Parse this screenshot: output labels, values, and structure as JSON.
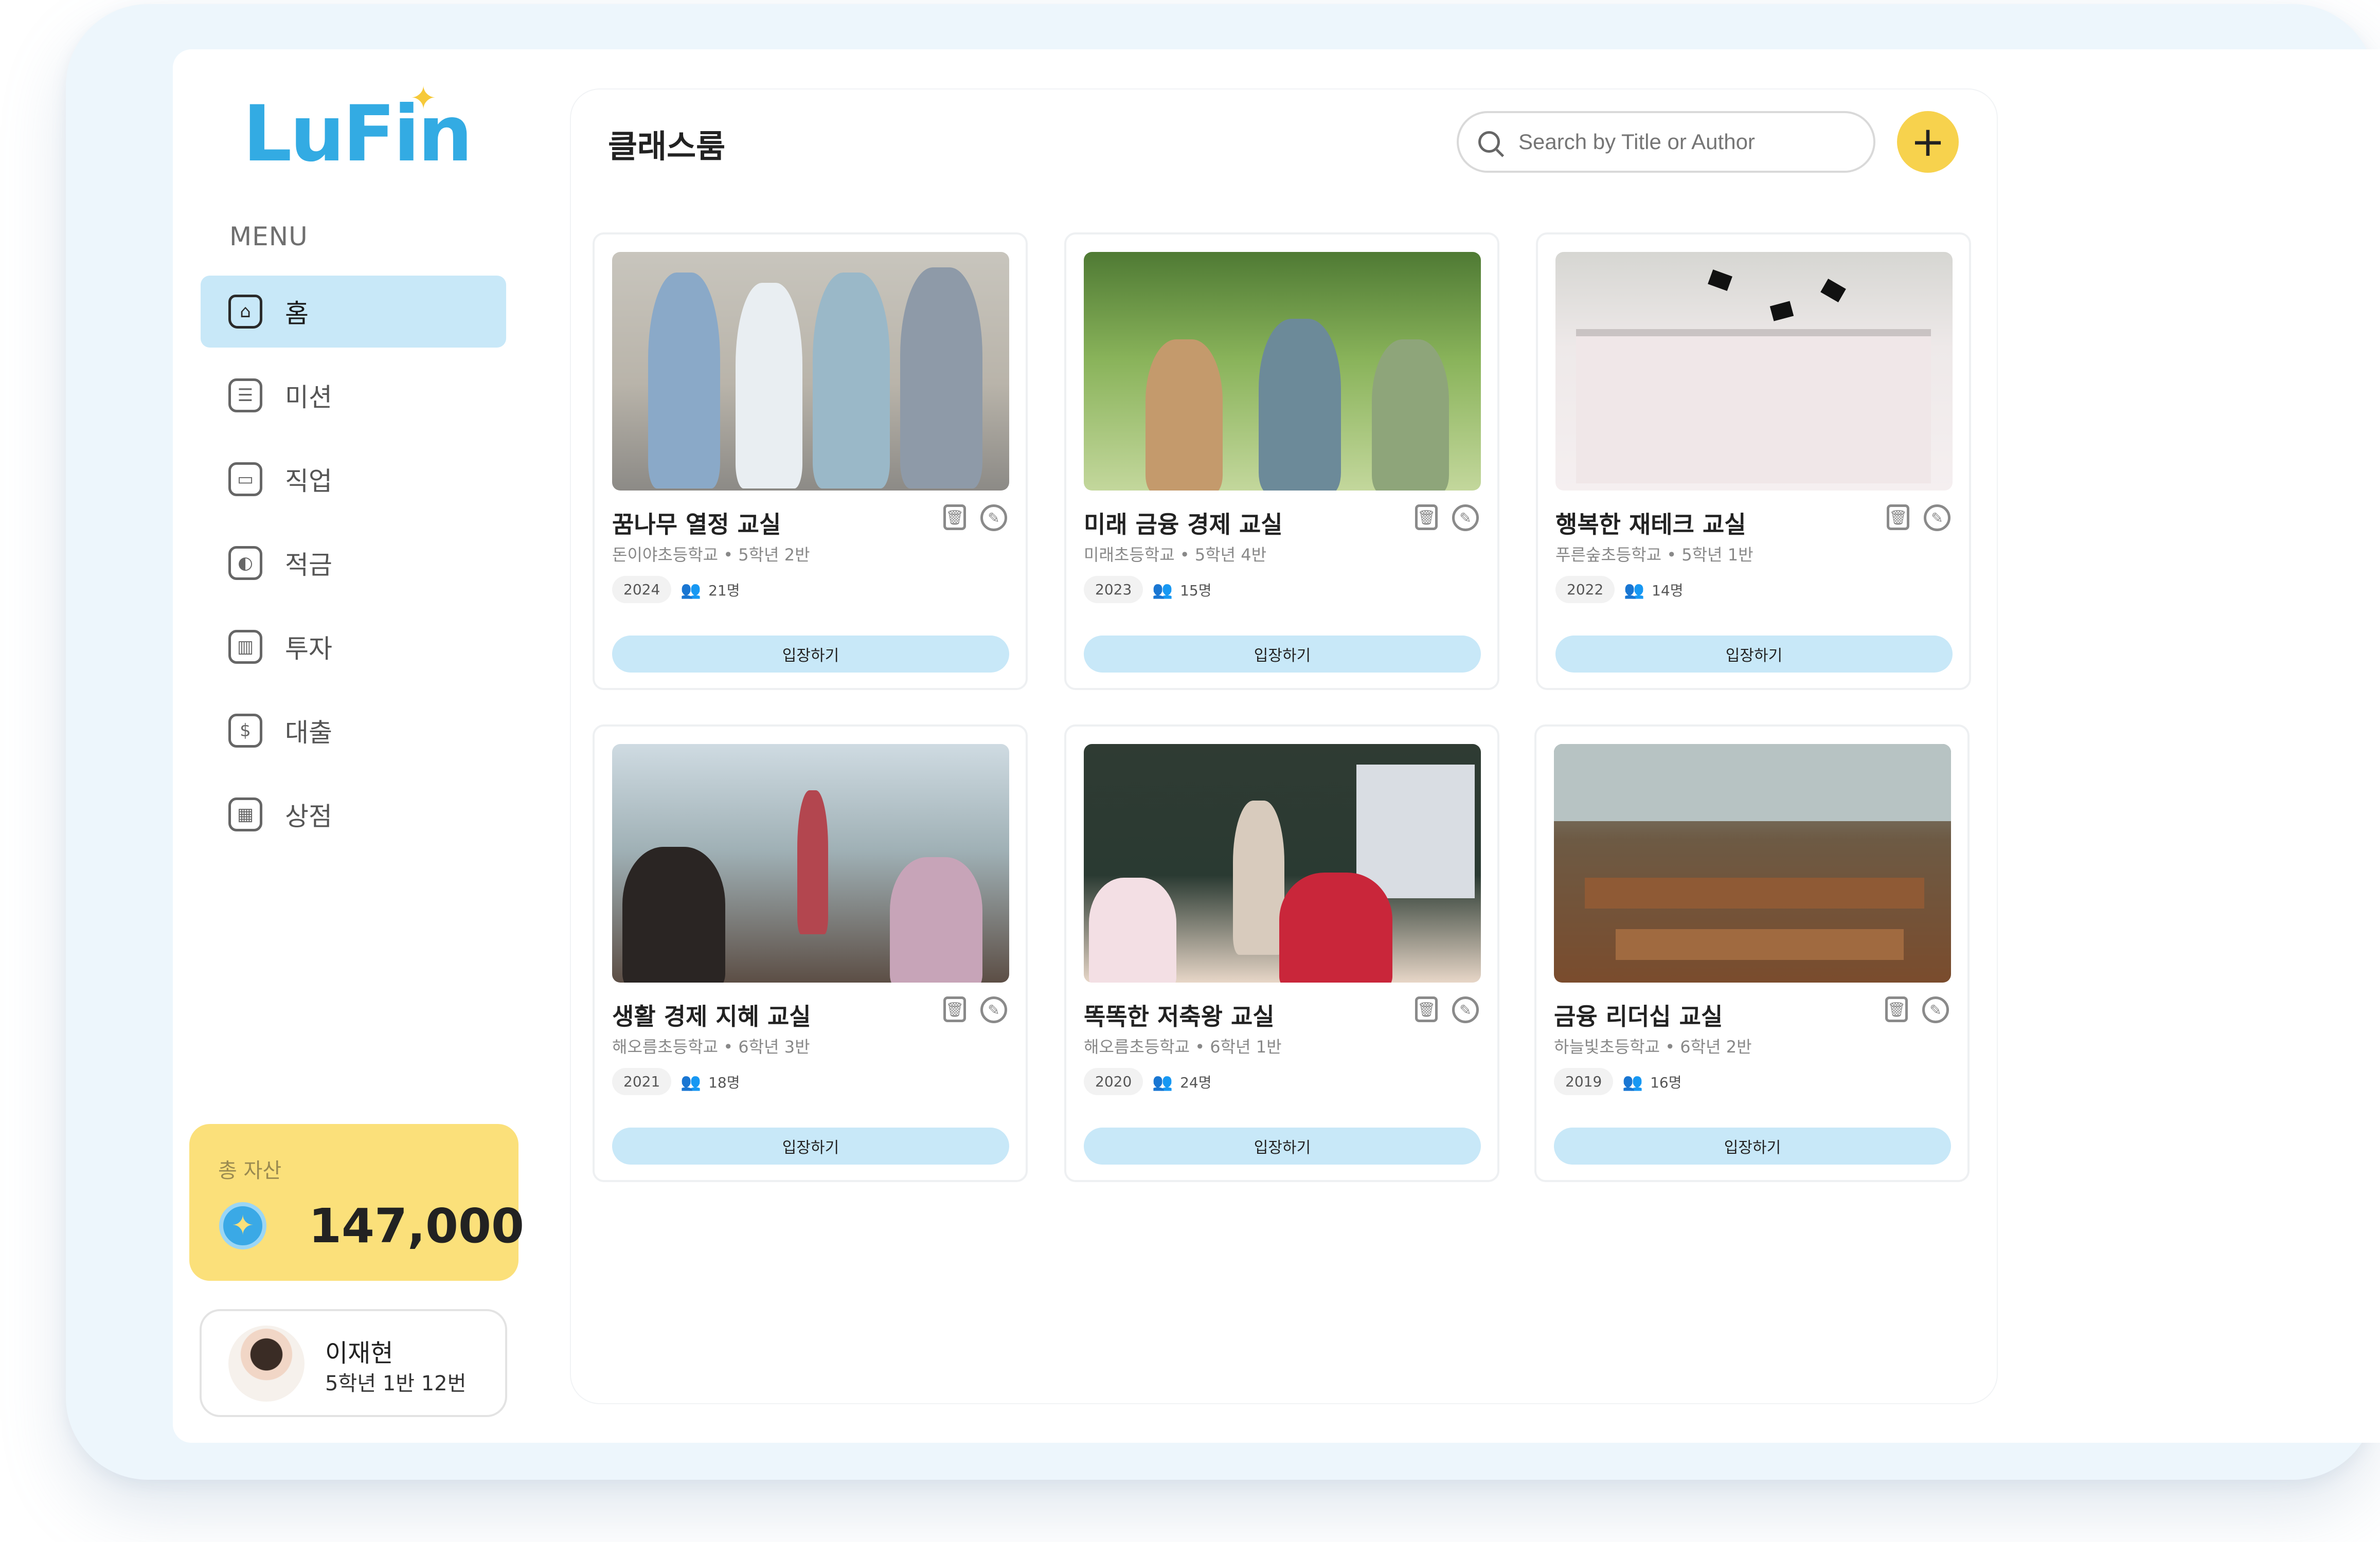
{
  "app": {
    "logo_text": "LuFin",
    "brand_color": "#33abe3",
    "accent_color": "#f7d24d"
  },
  "sidebar": {
    "menu_title": "MENU",
    "items": [
      {
        "label": "홈",
        "icon": "home-icon",
        "active": true
      },
      {
        "label": "미션",
        "icon": "checklist-icon",
        "active": false
      },
      {
        "label": "직업",
        "icon": "briefcase-icon",
        "active": false
      },
      {
        "label": "적금",
        "icon": "wallet-icon",
        "active": false
      },
      {
        "label": "투자",
        "icon": "chart-icon",
        "active": false
      },
      {
        "label": "대출",
        "icon": "dollar-icon",
        "active": false
      },
      {
        "label": "상점",
        "icon": "store-icon",
        "active": false
      }
    ],
    "asset": {
      "label": "총 자산",
      "value": "147,000",
      "icon": "coin-icon"
    },
    "profile": {
      "name": "이재현",
      "detail": "5학년 1반 12번"
    }
  },
  "main": {
    "title": "클래스룸",
    "search": {
      "placeholder": "Search by Title or Author",
      "value": ""
    },
    "add_button": "+",
    "cards": [
      {
        "title": "꿈나무 열정 교실",
        "school": "돈이야초등학교 • 5학년 2반",
        "year": "2024",
        "count": "21명",
        "button": "입장하기"
      },
      {
        "title": "미래 금융 경제 교실",
        "school": "미래초등학교 • 5학년 4반",
        "year": "2023",
        "count": "15명",
        "button": "입장하기"
      },
      {
        "title": "행복한 재테크 교실",
        "school": "푸른숲초등학교 • 5학년 1반",
        "year": "2022",
        "count": "14명",
        "button": "입장하기"
      },
      {
        "title": "생활 경제 지혜 교실",
        "school": "해오름초등학교 • 6학년 3반",
        "year": "2021",
        "count": "18명",
        "button": "입장하기"
      },
      {
        "title": "똑똑한 저축왕 교실",
        "school": "해오름초등학교 • 6학년 1반",
        "year": "2020",
        "count": "24명",
        "button": "입장하기"
      },
      {
        "title": "금융 리더십 교실",
        "school": "하늘빛초등학교 • 6학년 2반",
        "year": "2019",
        "count": "16명",
        "button": "입장하기"
      }
    ]
  }
}
